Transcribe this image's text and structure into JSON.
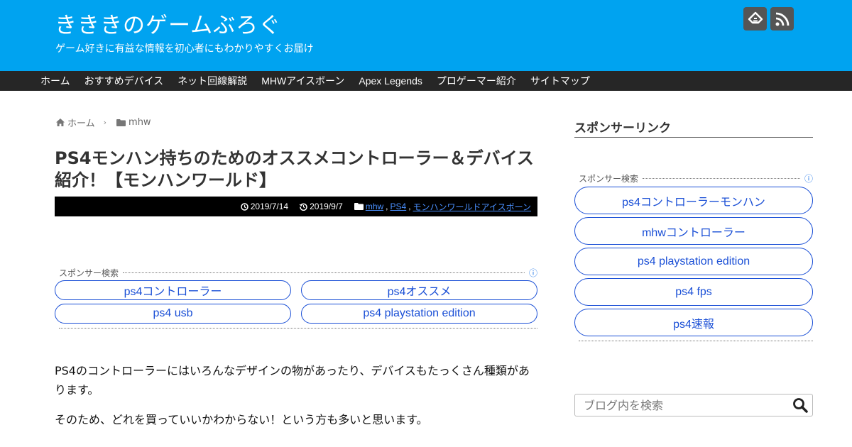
{
  "header": {
    "site_title": "きききのゲームぶろぐ",
    "site_description": "ゲーム好きに有益な情報を初心者にもわかりやすくお届け",
    "icons": [
      "feedly-icon",
      "rss-icon"
    ],
    "bg_color": "#00a3f0"
  },
  "nav": {
    "items": [
      "ホーム",
      "おすすめデバイス",
      "ネット回線解説",
      "MHWアイスボーン",
      "Apex Legends",
      "プロゲーマー紹介",
      "サイトマップ"
    ]
  },
  "breadcrumb": {
    "home": "ホーム",
    "category": "mhw"
  },
  "article": {
    "title": "PS4モンハン持ちのためのオススメコントローラー＆デバイス紹介！【モンハンワールド】",
    "published": "2019/7/14",
    "updated": "2019/9/7",
    "categories": [
      "mhw",
      "PS4",
      "モンハンワールドアイスボーン"
    ],
    "ad_label": "スポンサー検索",
    "ad_links": [
      "ps4コントローラー",
      "ps4オススメ",
      "ps4 usb",
      "ps4 playstation edition"
    ],
    "paragraphs": [
      "PS4のコントローラーにはいろんなデザインの物があったり、デバイスもたっくさん種類があります。",
      "そのため、どれを買っていいかわからない！という方も多いと思います。"
    ]
  },
  "sidebar": {
    "heading": "スポンサーリンク",
    "ad_label": "スポンサー検索",
    "ad_links": [
      "ps4コントローラーモンハン",
      "mhwコントローラー",
      "ps4 playstation edition",
      "ps4 fps",
      "ps4速報"
    ],
    "search_placeholder": "ブログ内を検索"
  },
  "colors": {
    "accent": "#00a3f0",
    "nav_bg": "#262626",
    "link_blue": "#1a4fd6"
  }
}
